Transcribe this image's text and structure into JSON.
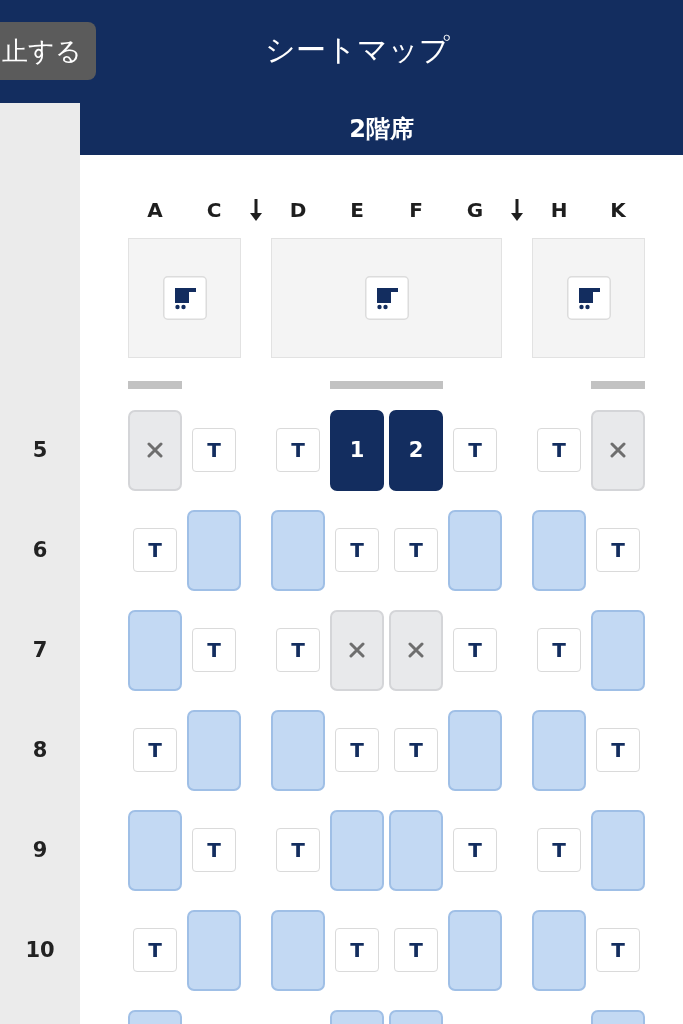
{
  "header": {
    "left_button": "止する",
    "title": "シートマップ"
  },
  "deck": {
    "title": "2階席",
    "blocks": [
      {
        "columns": [
          {
            "letter": "A",
            "bar": true
          },
          {
            "letter": "C",
            "bar": false
          }
        ]
      },
      {
        "columns": [
          {
            "letter": "D",
            "bar": false
          },
          {
            "letter": "E",
            "bar": true
          },
          {
            "letter": "F",
            "bar": true
          },
          {
            "letter": "G",
            "bar": false
          }
        ]
      },
      {
        "columns": [
          {
            "letter": "H",
            "bar": false
          },
          {
            "letter": "K",
            "bar": true
          }
        ]
      }
    ],
    "rows": [
      {
        "number": "5",
        "seats": [
          {
            "kind": "seat",
            "taken": true,
            "selected": false
          },
          {
            "kind": "tag",
            "label": "T"
          },
          {
            "kind": "tag",
            "label": "T"
          },
          {
            "kind": "seat",
            "selected": true,
            "label": "1"
          },
          {
            "kind": "seat",
            "selected": true,
            "label": "2"
          },
          {
            "kind": "tag",
            "label": "T"
          },
          {
            "kind": "tag",
            "label": "T"
          },
          {
            "kind": "seat",
            "taken": true,
            "selected": false
          }
        ]
      },
      {
        "number": "6",
        "seats": [
          {
            "kind": "tag",
            "label": "T"
          },
          {
            "kind": "seat",
            "taken": false,
            "selected": false
          },
          {
            "kind": "seat",
            "taken": false,
            "selected": false
          },
          {
            "kind": "tag",
            "label": "T"
          },
          {
            "kind": "tag",
            "label": "T"
          },
          {
            "kind": "seat",
            "taken": false,
            "selected": false
          },
          {
            "kind": "seat",
            "taken": false,
            "selected": false
          },
          {
            "kind": "tag",
            "label": "T"
          }
        ]
      },
      {
        "number": "7",
        "seats": [
          {
            "kind": "seat",
            "taken": false,
            "selected": false
          },
          {
            "kind": "tag",
            "label": "T"
          },
          {
            "kind": "tag",
            "label": "T"
          },
          {
            "kind": "seat",
            "taken": true,
            "selected": false
          },
          {
            "kind": "seat",
            "taken": true,
            "selected": false
          },
          {
            "kind": "tag",
            "label": "T"
          },
          {
            "kind": "tag",
            "label": "T"
          },
          {
            "kind": "seat",
            "taken": false,
            "selected": false
          }
        ]
      },
      {
        "number": "8",
        "seats": [
          {
            "kind": "tag",
            "label": "T"
          },
          {
            "kind": "seat",
            "taken": false,
            "selected": false
          },
          {
            "kind": "seat",
            "taken": false,
            "selected": false
          },
          {
            "kind": "tag",
            "label": "T"
          },
          {
            "kind": "tag",
            "label": "T"
          },
          {
            "kind": "seat",
            "taken": false,
            "selected": false
          },
          {
            "kind": "seat",
            "taken": false,
            "selected": false
          },
          {
            "kind": "tag",
            "label": "T"
          }
        ]
      },
      {
        "number": "9",
        "seats": [
          {
            "kind": "seat",
            "taken": false,
            "selected": false
          },
          {
            "kind": "tag",
            "label": "T"
          },
          {
            "kind": "tag",
            "label": "T"
          },
          {
            "kind": "seat",
            "taken": false,
            "selected": false
          },
          {
            "kind": "seat",
            "taken": false,
            "selected": false
          },
          {
            "kind": "tag",
            "label": "T"
          },
          {
            "kind": "tag",
            "label": "T"
          },
          {
            "kind": "seat",
            "taken": false,
            "selected": false
          }
        ]
      },
      {
        "number": "10",
        "seats": [
          {
            "kind": "tag",
            "label": "T"
          },
          {
            "kind": "seat",
            "taken": false,
            "selected": false
          },
          {
            "kind": "seat",
            "taken": false,
            "selected": false
          },
          {
            "kind": "tag",
            "label": "T"
          },
          {
            "kind": "tag",
            "label": "T"
          },
          {
            "kind": "seat",
            "taken": false,
            "selected": false
          },
          {
            "kind": "seat",
            "taken": false,
            "selected": false
          },
          {
            "kind": "tag",
            "label": "T"
          }
        ]
      },
      {
        "seats": [
          {
            "kind": "seat",
            "taken": false,
            "selected": false
          },
          {
            "kind": "offscreen"
          },
          {
            "kind": "offscreen"
          },
          {
            "kind": "seat",
            "taken": false,
            "selected": false
          },
          {
            "kind": "seat",
            "taken": false,
            "selected": false
          },
          {
            "kind": "offscreen"
          },
          {
            "kind": "offscreen"
          },
          {
            "kind": "seat",
            "taken": false,
            "selected": false
          }
        ]
      }
    ]
  }
}
